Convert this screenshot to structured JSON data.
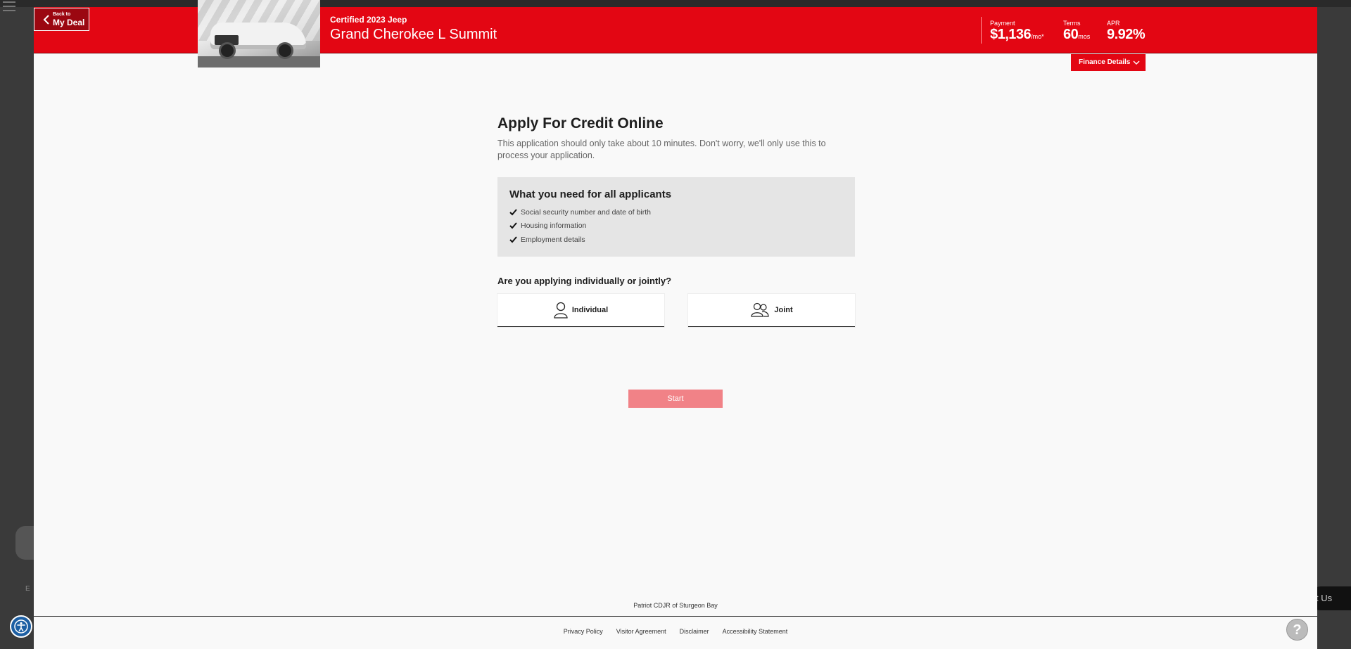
{
  "background": {
    "chat_fragment": "t Us",
    "side_fragment": "E"
  },
  "header": {
    "back": {
      "small": "Back to",
      "big": "My Deal"
    },
    "vehicle_subtitle": "Certified 2023 Jeep",
    "vehicle_title": "Grand Cherokee L Summit",
    "finance": {
      "payment_label": "Payment",
      "payment_value": "$1,136",
      "payment_unit": "/mo*",
      "terms_label": "Terms",
      "terms_value": "60",
      "terms_unit": "mos",
      "apr_label": "APR",
      "apr_value": "9.92%"
    },
    "finance_details_label": "Finance Details"
  },
  "main": {
    "title": "Apply For Credit Online",
    "description": "This application should only take about 10 minutes. Don't worry, we'll only use this to process your application.",
    "needs": {
      "title": "What you need for all applicants",
      "items": [
        "Social security number and date of birth",
        "Housing information",
        "Employment details"
      ]
    },
    "question": "Are you applying individually or jointly?",
    "choices": {
      "individual": "Individual",
      "joint": "Joint"
    },
    "start_label": "Start"
  },
  "footer": {
    "dealer_name": "Patriot CDJR of Sturgeon Bay",
    "links": [
      "Privacy Policy",
      "Visitor Agreement",
      "Disclaimer",
      "Accessibility Statement"
    ]
  },
  "help_label": "?",
  "colors": {
    "brand_red": "#e30613",
    "start_disabled": "#f18287"
  }
}
